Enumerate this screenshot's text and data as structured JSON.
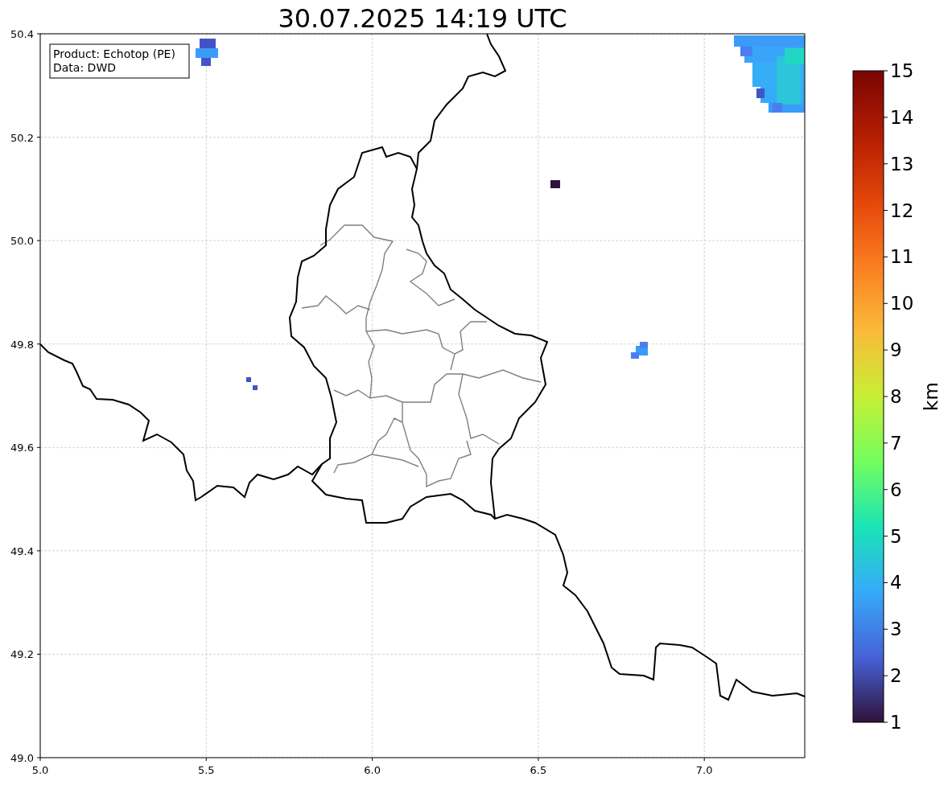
{
  "title": "30.07.2025 14:19 UTC",
  "info_box": [
    "Product: Echotop (PE)",
    "Data: DWD"
  ],
  "x_ticks": [
    "5.0",
    "5.5",
    "6.0",
    "6.5",
    "7.0"
  ],
  "y_ticks": [
    "50.4",
    "50.2",
    "50.0",
    "49.8",
    "49.6",
    "49.4",
    "49.2",
    "49.0"
  ],
  "colorbar": {
    "label": "km",
    "ticks": [
      "15",
      "14",
      "13",
      "12",
      "11",
      "10",
      "9",
      "8",
      "7",
      "6",
      "5",
      "4",
      "3",
      "2",
      "1"
    ]
  }
}
